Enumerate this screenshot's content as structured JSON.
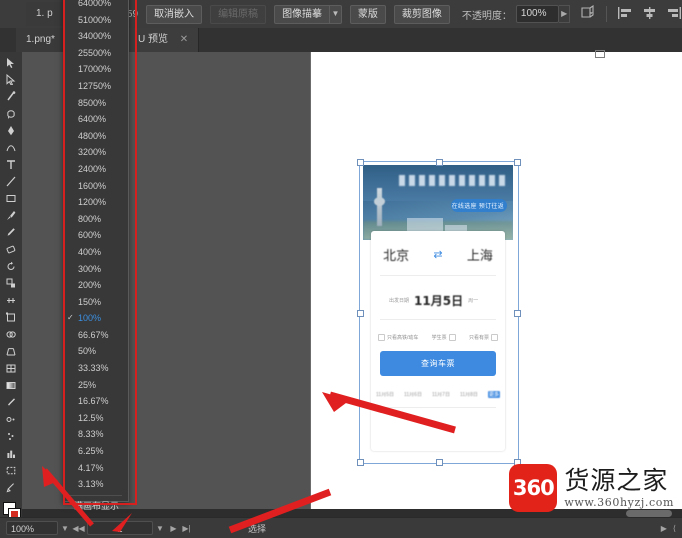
{
  "app": {
    "name": "Adobe Illustrator",
    "theme_bg": "#3a3a3a",
    "accent": "#3b8fe0"
  },
  "control_bar": {
    "dimensions": "122x59",
    "unembed_label": "取消嵌入",
    "edit_original_label": "编辑原稿",
    "image_trace_label": "图像描摹",
    "mask_label": "蒙版",
    "crop_image_label": "裁剪图像",
    "opacity_label": "不透明度：",
    "opacity_value": "100%",
    "transform_icon": "transform-icon",
    "align_left_icon": "align-left-icon",
    "align_center_icon": "align-center-icon",
    "align_right_icon": "align-right-icon"
  },
  "tabs": {
    "background_tab": "1. p",
    "active_tab": "1.png*",
    "preview_tab": "U 预览",
    "close_icon": "close-icon"
  },
  "zoom_menu": {
    "items": [
      "64000%",
      "51000%",
      "34000%",
      "25500%",
      "17000%",
      "12750%",
      "8500%",
      "6400%",
      "4800%",
      "3200%",
      "2400%",
      "1600%",
      "1200%",
      "800%",
      "600%",
      "400%",
      "300%",
      "200%",
      "150%",
      "100%",
      "66.67%",
      "50%",
      "33.33%",
      "25%",
      "16.67%",
      "12.5%",
      "8.33%",
      "6.25%",
      "4.17%",
      "3.13%"
    ],
    "selected": "100%",
    "fit_item": "满画布显示",
    "check_icon": "checkmark-icon"
  },
  "artwork": {
    "banner_text": "在线选座 预订往返",
    "origin_city": "北京",
    "destination_city": "上海",
    "swap_icon": "swap-arrows-icon",
    "date_label": "出发日期",
    "date_value": "11月5日",
    "date_weekday": "周一",
    "option_1": "只看高铁/动车",
    "option_2": "学生票",
    "option_3": "只看有票",
    "search_button": "查询车票",
    "quick_links": [
      "11月5日",
      "11月6日",
      "11月7日",
      "11月8日",
      "更多"
    ],
    "button_color": "#3d8ae0"
  },
  "status_bar": {
    "zoom_value": "100%",
    "zoom_caret_icon": "chevron-down-icon",
    "prev_page_icon": "prev-page-icon",
    "page_value": "1",
    "next_page_icon": "next-page-icon",
    "page_caret_icon": "chevron-down-icon",
    "play_icon": "play-icon",
    "last_icon": "last-page-icon",
    "mode_label": "选择",
    "right_play_icon": "play-icon",
    "right_back_icon": "back-icon"
  },
  "watermark": {
    "badge": "360",
    "title": "货源之家",
    "url": "www.360hyzj.com",
    "badge_color": "#e2231a"
  },
  "tools": {
    "items": [
      "selection-tool-icon",
      "direct-selection-tool-icon",
      "magic-wand-tool-icon",
      "lasso-tool-icon",
      "pen-tool-icon",
      "curvature-tool-icon",
      "type-tool-icon",
      "line-tool-icon",
      "rectangle-tool-icon",
      "paintbrush-tool-icon",
      "pencil-tool-icon",
      "eraser-tool-icon",
      "rotate-tool-icon",
      "scale-tool-icon",
      "width-tool-icon",
      "free-transform-tool-icon",
      "shape-builder-tool-icon",
      "perspective-grid-tool-icon",
      "mesh-tool-icon",
      "gradient-tool-icon",
      "eyedropper-tool-icon",
      "blend-tool-icon",
      "symbol-sprayer-tool-icon",
      "column-graph-tool-icon",
      "artboard-tool-icon",
      "slice-tool-icon",
      "hand-tool-icon",
      "zoom-tool-icon"
    ],
    "fill_swatch": "fill-swatch",
    "stroke_swatch": "stroke-swatch"
  }
}
